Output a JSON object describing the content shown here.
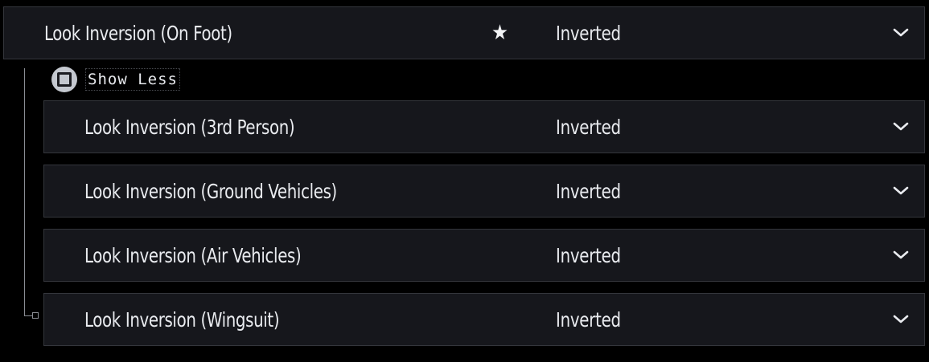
{
  "main_setting": {
    "label": "Look Inversion (On Foot)",
    "value": "Inverted",
    "favorite_icon": "star-icon",
    "dropdown_icon": "chevron-down-icon"
  },
  "toggle": {
    "label": "Show Less",
    "button_icon": "square-button-icon"
  },
  "sub_settings": [
    {
      "label": "Look Inversion (3rd Person)",
      "value": "Inverted"
    },
    {
      "label": "Look Inversion (Ground Vehicles)",
      "value": "Inverted"
    },
    {
      "label": "Look Inversion (Air Vehicles)",
      "value": "Inverted"
    },
    {
      "label": "Look Inversion (Wingsuit)",
      "value": "Inverted"
    }
  ],
  "colors": {
    "background": "#000000",
    "row_background": "#16171c",
    "row_border": "#34363c",
    "text": "#e9ebef",
    "tree_line": "#8a8d94",
    "button_icon": "#c4c8cf"
  }
}
